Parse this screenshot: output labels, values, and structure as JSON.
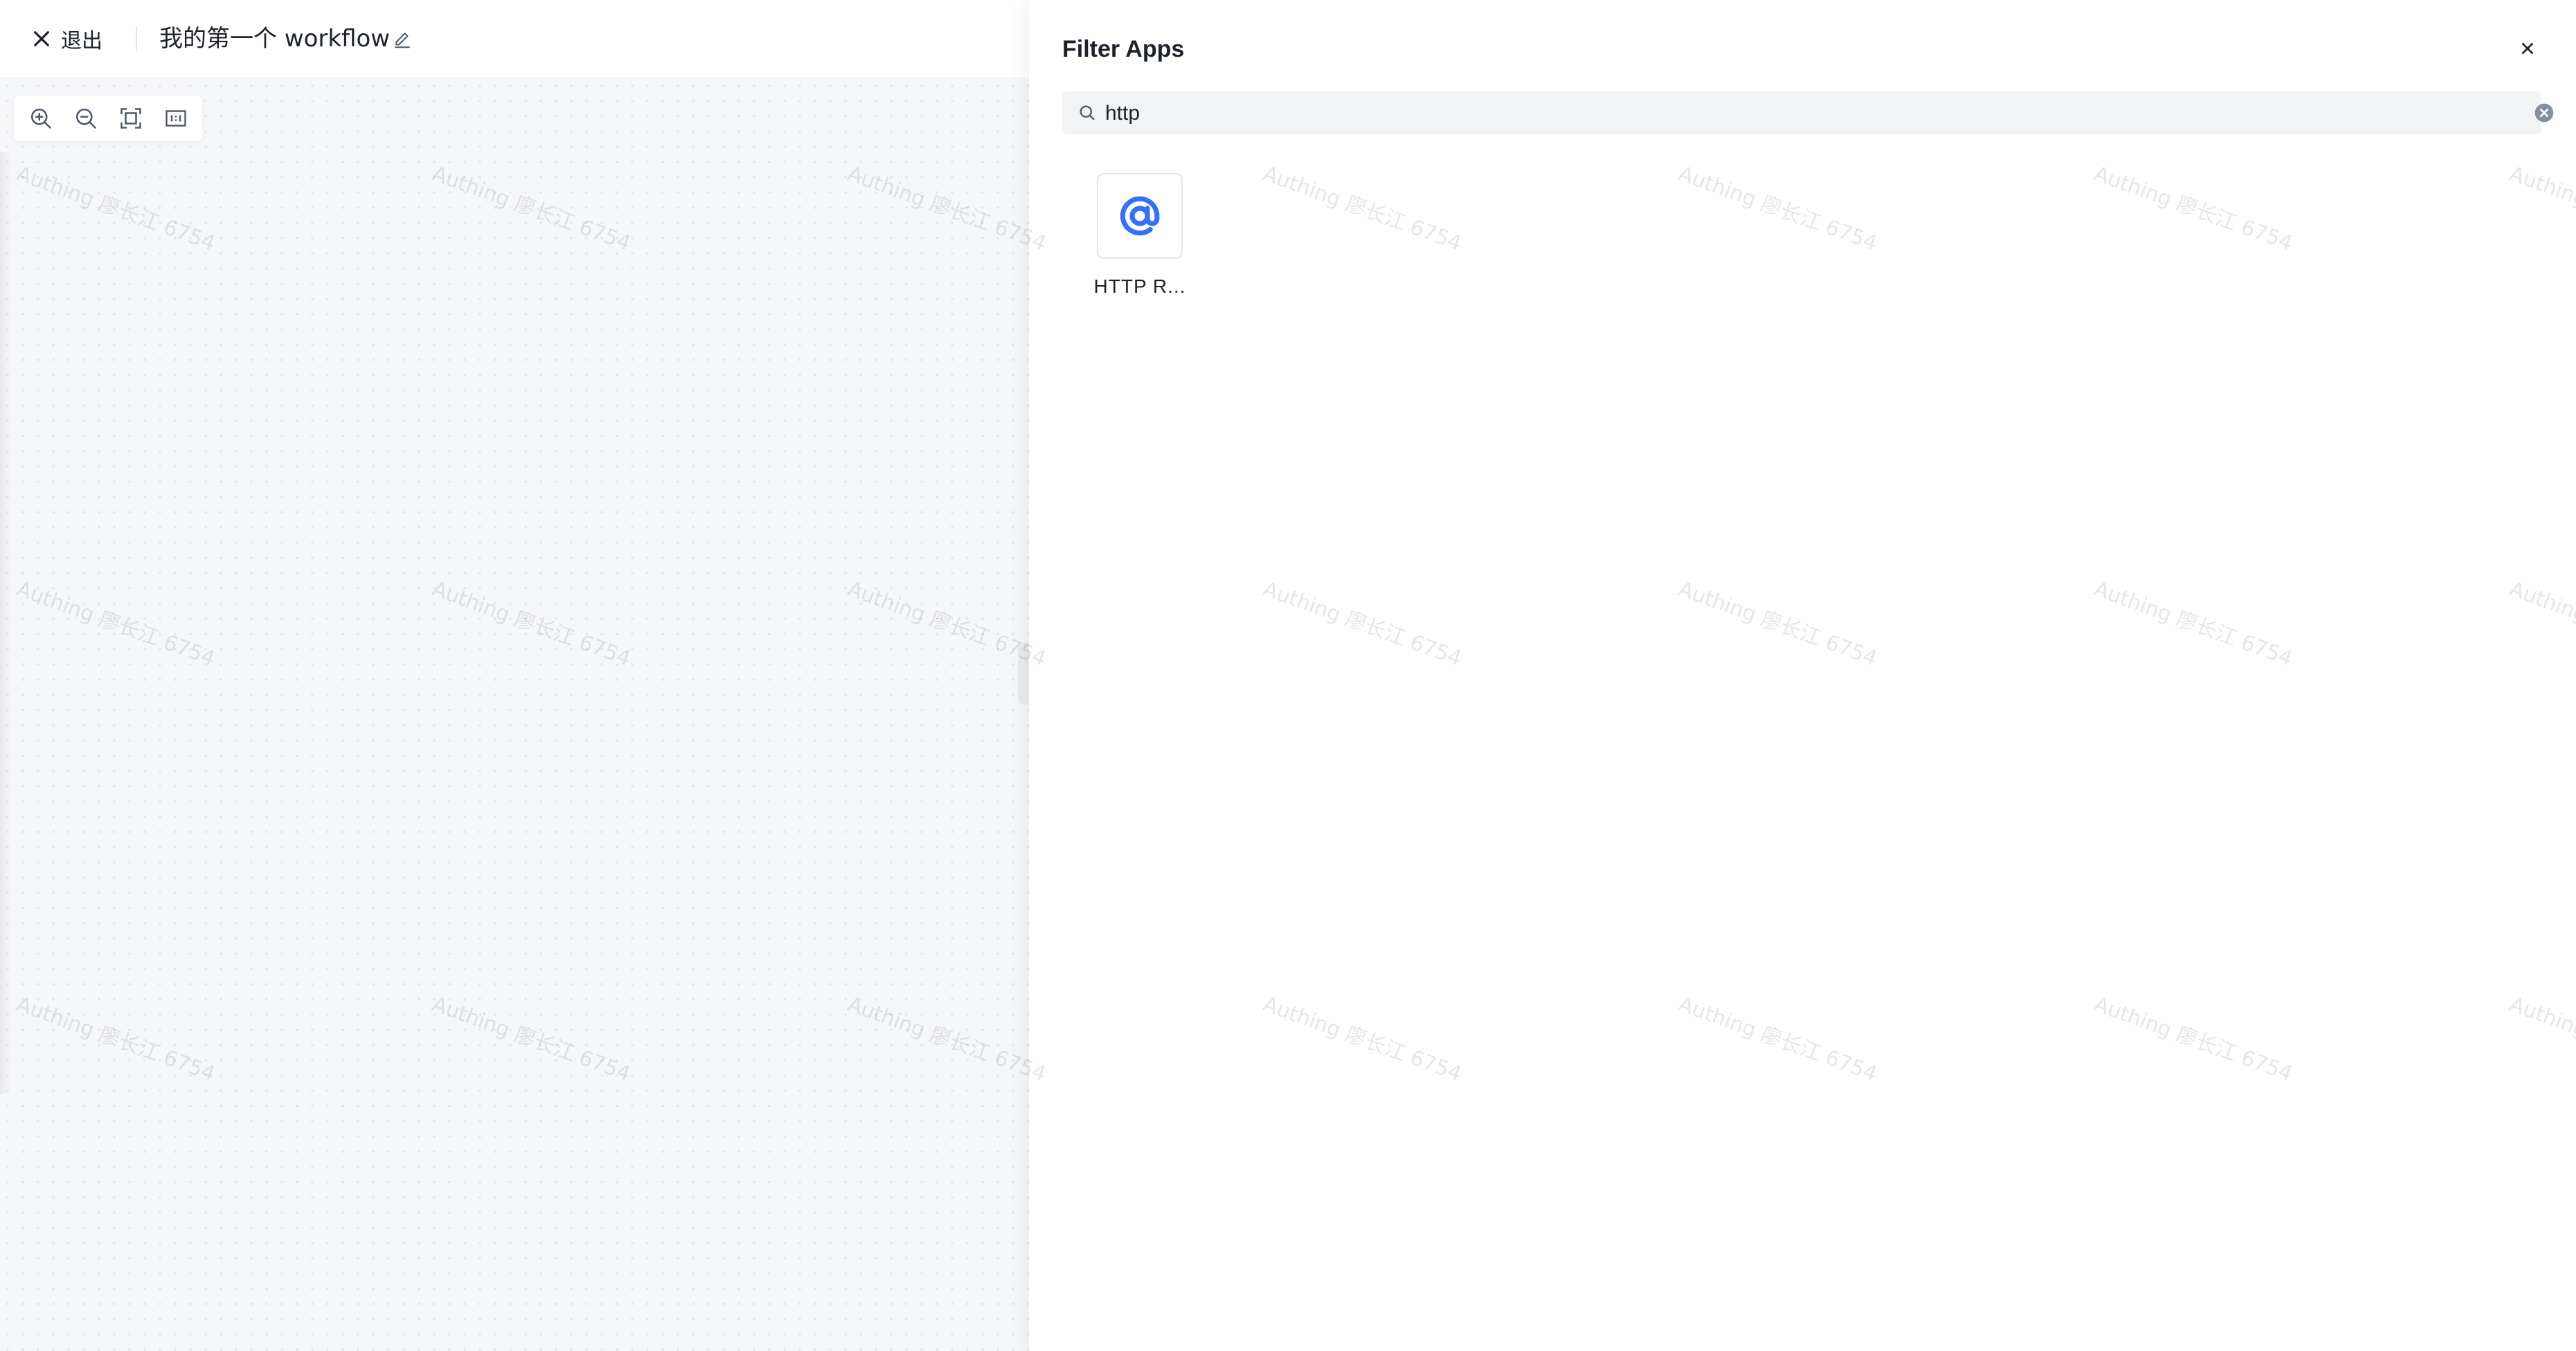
{
  "header": {
    "exit_label": "退出",
    "workflow_title": "我的第一个 workflow"
  },
  "zoom_controls": [
    "zoom-in-icon",
    "zoom-out-icon",
    "fit-view-icon",
    "actual-size-icon"
  ],
  "drawer": {
    "title": "Filter Apps",
    "search": {
      "value": "http",
      "placeholder": ""
    },
    "apps": [
      {
        "name": "HTTP R...",
        "icon": "at-sign-icon"
      }
    ]
  },
  "watermark": {
    "text": "Authing 廖长江 6754"
  },
  "colors": {
    "accent": "#3370ff",
    "canvas_bg": "#f6f7f9",
    "text": "#1d2129"
  }
}
